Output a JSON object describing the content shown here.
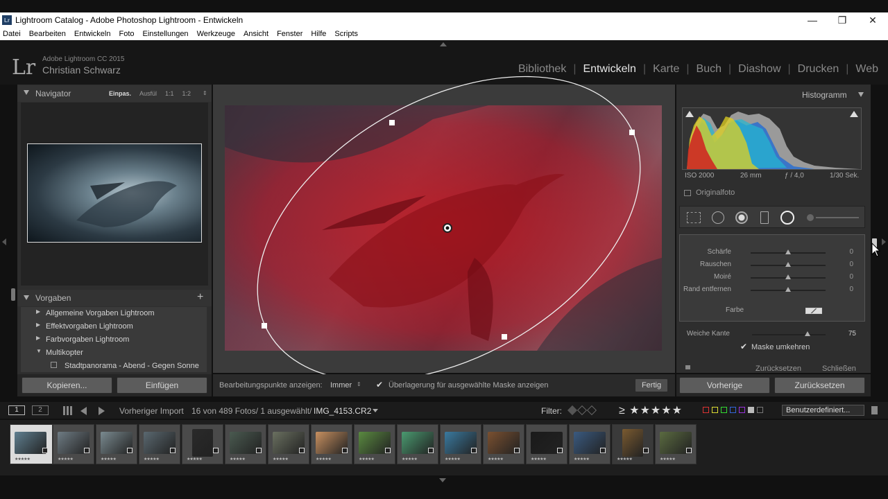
{
  "window": {
    "title": "Lightroom Catalog - Adobe Photoshop Lightroom - Entwickeln",
    "logo": "Lr",
    "minimize": "—",
    "restore": "❐",
    "close": "✕"
  },
  "menu": [
    "Datei",
    "Bearbeiten",
    "Entwickeln",
    "Foto",
    "Einstellungen",
    "Werkzeuge",
    "Ansicht",
    "Fenster",
    "Hilfe",
    "Scripts"
  ],
  "identity": {
    "mark": "Lr",
    "product": "Adobe Lightroom CC 2015",
    "user": "Christian Schwarz"
  },
  "modules": [
    {
      "label": "Bibliothek"
    },
    {
      "label": "Entwickeln",
      "active": true
    },
    {
      "label": "Karte"
    },
    {
      "label": "Buch"
    },
    {
      "label": "Diashow"
    },
    {
      "label": "Drucken"
    },
    {
      "label": "Web"
    }
  ],
  "navigator": {
    "title": "Navigator",
    "zoom": [
      "Einpas.",
      "Ausfül",
      "1:1",
      "1:2"
    ]
  },
  "presets": {
    "title": "Vorgaben",
    "add": "+",
    "items": [
      "Allgemeine Vorgaben Lightroom",
      "Effektvorgaben Lightroom",
      "Farbvorgaben Lightroom",
      "Multikopter"
    ],
    "subitem": "Stadtpanorama - Abend - Gegen Sonne"
  },
  "left_buttons": {
    "copy": "Kopieren...",
    "paste": "Einfügen"
  },
  "toolbar": {
    "points_label": "Bearbeitungspunkte anzeigen:",
    "points_value": "Immer",
    "overlay_check": "✔",
    "overlay_label": "Überlagerung für ausgewählte Maske anzeigen",
    "done": "Fertig"
  },
  "histogram": {
    "title": "Histogramm",
    "iso": "ISO 2000",
    "focal": "26 mm",
    "aperture": "ƒ / 4,0",
    "shutter": "1/30 Sek.",
    "original_label": "Originalfoto"
  },
  "sliders": [
    {
      "label": "Schärfe",
      "value": "0",
      "pos": 0.5
    },
    {
      "label": "Rauschen",
      "value": "0",
      "pos": 0.5
    },
    {
      "label": "Moiré",
      "value": "0",
      "pos": 0.5
    },
    {
      "label": "Rand entfernen",
      "value": "0",
      "pos": 0.5
    }
  ],
  "color_label": "Farbe",
  "feather": {
    "label": "Weiche Kante",
    "value": "75",
    "pos": 0.75
  },
  "invert": {
    "check": "✔",
    "label": "Maske umkehren"
  },
  "mask_actions": {
    "reset": "Zurücksetzen",
    "close": "Schließen"
  },
  "right_buttons": {
    "prev": "Vorherige",
    "reset": "Zurücksetzen"
  },
  "filmstrip_bar": {
    "screen1": "1",
    "screen2": "2",
    "source": "Vorheriger Import",
    "count": "16 von 489 Fotos/ 1 ausgewählt/",
    "filename": "IMG_4153.CR2",
    "filter_label": "Filter:",
    "rating": "≥ ★★★★★",
    "preset": "Benutzerdefiniert..."
  },
  "thumb_stars": "★★★★★",
  "colors": {
    "mask_red": "#c8151e",
    "panel": "#383838",
    "accent": "#e6e6e6"
  }
}
